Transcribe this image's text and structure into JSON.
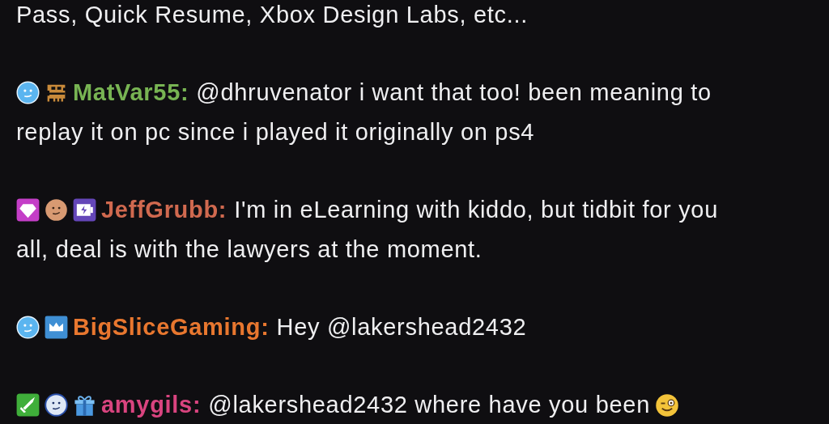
{
  "chat": {
    "continued_text": "Pass, Quick Resume, Xbox Design Labs, etc...",
    "messages": [
      {
        "username": "MatVar55:",
        "color": "#78b453",
        "lines": [
          "@dhruvenator i want that too! been meaning to",
          "replay it on pc since i played it originally on ps4"
        ],
        "badges": [
          {
            "kind": "smiley-blue"
          },
          {
            "kind": "train"
          }
        ]
      },
      {
        "username": "JeffGrubb:",
        "color": "#d0694f",
        "lines": [
          "I'm in eLearning with kiddo, but tidbit for you",
          "all, deal is with the lawyers at the moment."
        ],
        "badges": [
          {
            "kind": "gem"
          },
          {
            "kind": "smiley-copper"
          },
          {
            "kind": "battery"
          }
        ]
      },
      {
        "username": "BigSliceGaming:",
        "color": "#e8772f",
        "lines": [
          "Hey @lakershead2432"
        ],
        "badges": [
          {
            "kind": "smiley-blue"
          },
          {
            "kind": "crown"
          }
        ]
      },
      {
        "username": "amygils:",
        "color": "#d9447f",
        "lines": [
          "@lakershead2432 where have you been"
        ],
        "emoji": {
          "kind": "wink"
        },
        "badges": [
          {
            "kind": "sword"
          },
          {
            "kind": "smiley-silver"
          },
          {
            "kind": "gift"
          }
        ]
      }
    ]
  }
}
